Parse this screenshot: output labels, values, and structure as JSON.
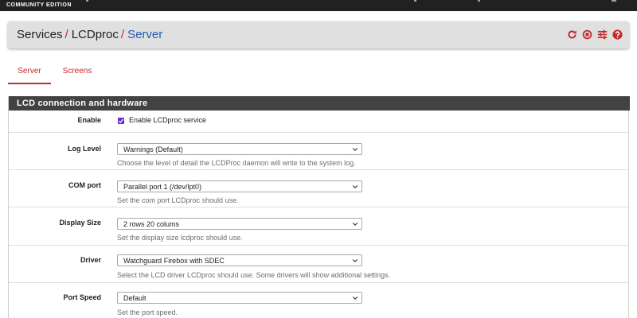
{
  "topbar": {
    "edition": "COMMUNITY EDITION"
  },
  "breadcrumb": {
    "item1": "Services",
    "item2": "LCDproc",
    "item3": "Server",
    "separator": "/"
  },
  "header_icons": [
    "refresh-icon",
    "stop-icon",
    "settings-sliders-icon",
    "help-icon"
  ],
  "tabs": [
    {
      "label": "Server",
      "active": true
    },
    {
      "label": "Screens",
      "active": false
    }
  ],
  "panel": {
    "title": "LCD connection and hardware"
  },
  "form": {
    "enable": {
      "label": "Enable",
      "checkbox_label": "Enable LCDproc service",
      "checked": true
    },
    "log_level": {
      "label": "Log Level",
      "value": "Warnings (Default)",
      "help": "Choose the level of detail the LCDProc daemon will write to the system log."
    },
    "com_port": {
      "label": "COM port",
      "value": "Parallel port 1 (/dev/lpt0)",
      "help": "Set the com port LCDproc should use."
    },
    "display_size": {
      "label": "Display Size",
      "value": "2 rows 20 colums",
      "help": "Set the display size lcdproc should use."
    },
    "driver": {
      "label": "Driver",
      "value": "Watchguard Firebox with SDEC",
      "help": "Select the LCD driver LCDproc should use. Some drivers will show additional settings."
    },
    "port_speed": {
      "label": "Port Speed",
      "value": "Default",
      "help": "Set the port speed."
    }
  },
  "colors": {
    "accent": "#c62828",
    "link": "#1e5bb3",
    "checkbox": "#6d28d9",
    "panel_header": "#424242",
    "topbar": "#212121"
  }
}
